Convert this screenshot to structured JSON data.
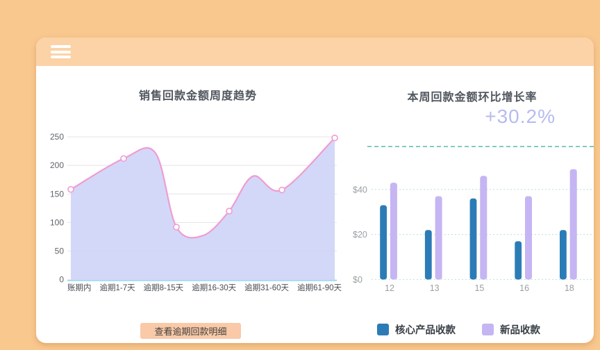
{
  "window": {
    "background_color": "#f9c88f",
    "header_color": "#fbd3a7"
  },
  "actions": {
    "view_detail_label": "查看逾期回款明细"
  },
  "chart_data": [
    {
      "type": "area",
      "title": "销售回款金额周度趋势",
      "categories": [
        "账期内",
        "逾期1-7天",
        "逾期8-15天",
        "逾期16-30天",
        "逾期31-60天",
        "逾期61-90天"
      ],
      "values": [
        158,
        212,
        92,
        120,
        157,
        248
      ],
      "curve_samples": [
        [
          0,
          158,
          1
        ],
        [
          1,
          212,
          1
        ],
        [
          1.6,
          222,
          0
        ],
        [
          2,
          92,
          1
        ],
        [
          2.5,
          77,
          0
        ],
        [
          3,
          120,
          1
        ],
        [
          3.45,
          181,
          0
        ],
        [
          4,
          157,
          1
        ],
        [
          5,
          248,
          1
        ]
      ],
      "ylim": [
        0,
        250
      ],
      "yticks": [
        0,
        50,
        100,
        150,
        200,
        250
      ],
      "grid": "horizontal-solid",
      "line_color": "#ef9cd2",
      "marker_fill": "#ffffff",
      "fill_color": "#cfd5f7",
      "axis_line_color": "#aadcf2",
      "grid_color": "#e4e4e8",
      "ytick_color": "#5f6368",
      "xtick_color": "#4a4e54"
    },
    {
      "type": "bar",
      "title": "本周回款金额环比增长率",
      "growth_label": "+30.2%",
      "growth_color": "#b7bbf0",
      "reference_line_color": "#7fccc4",
      "categories": [
        "12",
        "13",
        "15",
        "16",
        "18"
      ],
      "series": [
        {
          "name": "核心产品收款",
          "color": "#2b7cb6",
          "values": [
            33,
            22,
            36,
            17,
            22
          ]
        },
        {
          "name": "新品收款",
          "color": "#c6b5f3",
          "values": [
            43,
            37,
            46,
            37,
            49
          ]
        }
      ],
      "yticks": [
        {
          "label": "$0",
          "value": 0
        },
        {
          "label": "$20",
          "value": 20
        },
        {
          "label": "$40",
          "value": 40
        }
      ],
      "ylim": [
        0,
        50
      ],
      "grid": "horizontal-dotted",
      "grid_color": "#c2e6e2",
      "tick_color": "#9aa0a2",
      "legend_position": "bottom"
    }
  ]
}
